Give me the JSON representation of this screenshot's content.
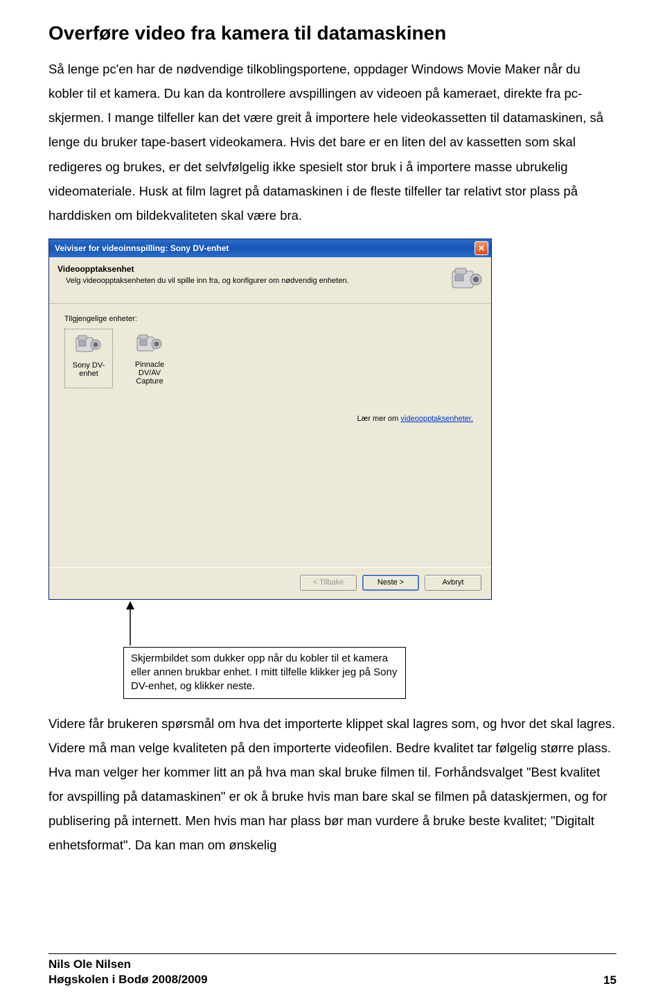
{
  "heading": "Overføre video fra kamera til datamaskinen",
  "para1": "Så lenge pc'en har de nødvendige tilkoblingsportene, oppdager Windows Movie Maker når du kobler til et kamera. Du kan da kontrollere avspillingen av videoen på kameraet, direkte fra pc-skjermen. I mange tilfeller kan det være greit å importere hele videokassetten til datamaskinen, så lenge du bruker tape-basert videokamera. Hvis det bare er en liten del av kassetten som skal redigeres og brukes, er det selvfølgelig ikke spesielt stor bruk i å importere masse ubrukelig videomateriale. Husk at film lagret på datamaskinen i de fleste tilfeller tar relativt stor plass på harddisken om bildekvaliteten skal være bra.",
  "dialog": {
    "title": "Veiviser for videoinnspilling: Sony DV-enhet",
    "header_title": "Videoopptaksenhet",
    "header_sub": "Velg videoopptaksenheten du vil spille inn fra, og konfigurer om nødvendig enheten.",
    "devices_label_pre": "Tilg",
    "devices_label_underlined": "j",
    "devices_label_post": "engelige enheter:",
    "devices": [
      {
        "label": "Sony DV-enhet"
      },
      {
        "label": "Pinnacle DV/AV Capture"
      }
    ],
    "learn_more_pre": "Lær mer om ",
    "learn_more_link": "videoopptaksenheter.",
    "buttons": {
      "back": "< Tilbake",
      "next": "Neste >",
      "cancel": "Avbryt"
    }
  },
  "annotation": "Skjermbildet som dukker opp når du kobler til et kamera eller annen brukbar enhet. I mitt tilfelle klikker jeg på Sony DV-enhet, og klikker neste.",
  "para2": "Videre får brukeren spørsmål om hva det importerte klippet skal lagres som, og hvor det skal lagres. Videre må man velge kvaliteten på den importerte videofilen. Bedre kvalitet tar følgelig større plass. Hva man velger her kommer litt an på hva man skal bruke filmen til. Forhåndsvalget \"Best kvalitet for avspilling på datamaskinen\" er ok å bruke hvis man bare skal se filmen på dataskjermen, og for publisering på internett. Men hvis man har plass bør man vurdere å bruke beste kvalitet; \"Digitalt enhetsformat\". Da kan man om ønskelig",
  "footer": {
    "author": "Nils Ole Nilsen",
    "org": "Høgskolen i Bodø 2008/2009",
    "page": "15"
  }
}
